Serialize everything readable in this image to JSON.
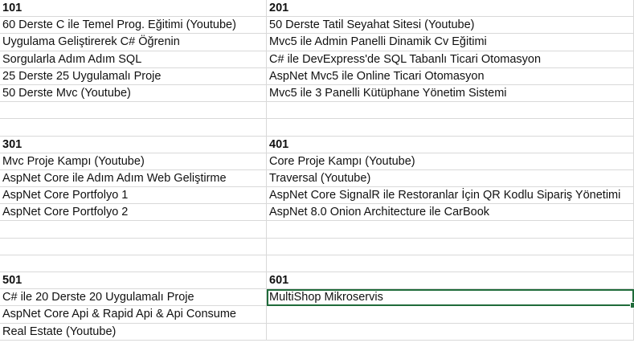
{
  "sheet": {
    "rows": [
      [
        "101",
        "201"
      ],
      [
        "60 Derste C ile Temel Prog. Eğitimi (Youtube)",
        "50 Derste Tatil Seyahat Sitesi (Youtube)"
      ],
      [
        "Uygulama Geliştirerek C# Öğrenin",
        "Mvc5 ile Admin Panelli Dinamik Cv Eğitimi"
      ],
      [
        "Sorgularla Adım Adım SQL",
        "C# ile DevExpress'de SQL Tabanlı Ticari Otomasyon"
      ],
      [
        "25 Derste 25 Uygulamalı Proje",
        "AspNet Mvc5 ile Online Ticari Otomasyon"
      ],
      [
        "50 Derste Mvc (Youtube)",
        "Mvc5 ile 3 Panelli Kütüphane Yönetim Sistemi"
      ],
      [
        "",
        ""
      ],
      [
        "",
        ""
      ],
      [
        "301",
        "401"
      ],
      [
        "Mvc Proje Kampı (Youtube)",
        "Core Proje Kampı (Youtube)"
      ],
      [
        "AspNet Core ile Adım Adım Web Geliştirme",
        "Traversal (Youtube)"
      ],
      [
        "AspNet Core Portfolyo 1",
        "AspNet Core SignalR ile Restoranlar İçin QR Kodlu Sipariş Yönetimi"
      ],
      [
        "AspNet Core Portfolyo 2",
        "AspNet 8.0 Onion Architecture ile CarBook"
      ],
      [
        "",
        ""
      ],
      [
        "",
        ""
      ],
      [
        "",
        ""
      ],
      [
        "501",
        "601"
      ],
      [
        "C# ile 20 Derste 20 Uygulamalı Proje",
        "MultiShop Mikroservis"
      ],
      [
        "AspNet Core Api & Rapid Api & Api Consume",
        ""
      ],
      [
        "Real Estate (Youtube)",
        ""
      ]
    ],
    "bold_rows": [
      0,
      8,
      16
    ],
    "selected_cell": [
      17,
      1
    ],
    "colors": {
      "gridline": "#d9d9d9",
      "selection": "#1f6b3a",
      "text": "#111111"
    }
  }
}
